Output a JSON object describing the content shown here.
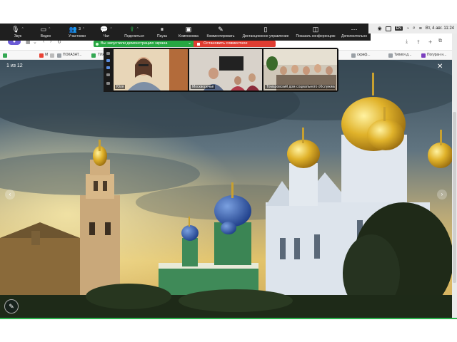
{
  "toolbar": {
    "items": [
      {
        "label": "Звук",
        "icon": "microphone-icon",
        "glyph": "🎙"
      },
      {
        "label": "Видео",
        "icon": "video-camera-icon",
        "glyph": "▭"
      },
      {
        "label": "Участники",
        "icon": "participants-icon",
        "glyph": "👥",
        "count": "3"
      },
      {
        "label": "Чат",
        "icon": "chat-icon",
        "glyph": "💬"
      },
      {
        "label": "Поделиться",
        "icon": "share-screen-icon",
        "glyph": "⇪"
      },
      {
        "label": "Пауза",
        "icon": "pause-icon",
        "glyph": "⏸"
      },
      {
        "label": "Компоновка",
        "icon": "layout-icon",
        "glyph": "▣"
      },
      {
        "label": "Комментировать",
        "icon": "annotate-pen-icon",
        "glyph": "✎"
      },
      {
        "label": "Дистанционное управление",
        "icon": "remote-control-icon",
        "glyph": "🖱"
      },
      {
        "label": "Показать конференцию",
        "icon": "show-meeting-icon",
        "glyph": "◫"
      },
      {
        "label": "Дополнительно",
        "icon": "more-icon",
        "glyph": "⋯"
      }
    ]
  },
  "menubar": {
    "keyboard_layout": "EN",
    "datetime": "Вт, 4 авг.  11:24"
  },
  "share": {
    "status": "Вы запустили демонстрацию экрана",
    "stop_label": "Остановить совместное использование"
  },
  "bookmarks": [
    {
      "label": "",
      "color": "#34a853"
    },
    {
      "label": "М",
      "color": "#ea4335"
    },
    {
      "label": "",
      "color": "#ffffff"
    },
    {
      "label": "ПОКАЗАТ...",
      "color": "#9aa0a6"
    },
    {
      "label": "",
      "color": "#34a853"
    },
    {
      "label": "ТИА",
      "color": "#4285f4"
    },
    {
      "label": "скриф...",
      "color": "#9aa0a6"
    },
    {
      "label": "Типиги д...",
      "color": "#9aa0a6"
    },
    {
      "label": "Погуран н...",
      "color": "#7b3fbf"
    }
  ],
  "viewer": {
    "counter": "1 из 12"
  },
  "video": {
    "tiles": [
      {
        "name": "Юля"
      },
      {
        "name": "Москворечье"
      },
      {
        "name": "Томаровский дом социального обслуживания"
      }
    ]
  },
  "colors": {
    "accent_green": "#26a742",
    "stop_red": "#e03c31",
    "toolbar_bg": "#1f1f1f"
  }
}
